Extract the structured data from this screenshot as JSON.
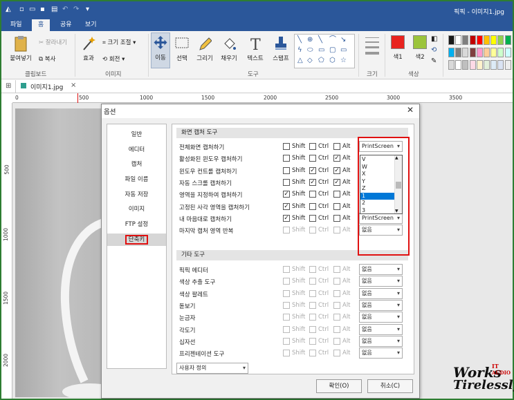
{
  "app": {
    "title": "픽픽 - 이미지1.jpg"
  },
  "tabs": [
    "파일",
    "홈",
    "공유",
    "보기"
  ],
  "ribbon": {
    "paste": "붙여넣기",
    "cut": "잘라내기",
    "copy": "복사",
    "effect": "효과",
    "resize": "크기 조절",
    "rotate": "회전",
    "move": "이동",
    "select": "선택",
    "draw": "그리기",
    "fill": "채우기",
    "text": "텍스트",
    "stamp": "스탬프",
    "size": "크기",
    "color1": "색1",
    "color2": "색2",
    "groups": {
      "clipboard": "클립보드",
      "image": "이미지",
      "tools": "도구",
      "size": "크기",
      "color": "색상"
    },
    "color1_hex": "#e8231f",
    "color2_hex": "#9bc43c",
    "palette": [
      "#1a1a1a",
      "#ffffff",
      "#7f7f7f",
      "#c00000",
      "#ff0000",
      "#ffc000",
      "#ffff00",
      "#92d050",
      "#00b050",
      "#00b0f0",
      "#7f7f7f",
      "#d9d9d9",
      "#7f3f3f",
      "#ff99cc",
      "#ffcc99",
      "#ffff99",
      "#ccffcc",
      "#ccffff",
      "#d9d9d9",
      "#ffffff",
      "#bfbfbf",
      "#ffd9e6",
      "#fff2cc",
      "#e2efda",
      "#ddebf7",
      "#dae3f3",
      "#ededed"
    ]
  },
  "doc": {
    "tab": "이미지1.jpg"
  },
  "ruler": {
    "h": [
      "0",
      "500",
      "1000",
      "1500",
      "2000",
      "2500",
      "3000",
      "3500"
    ],
    "v": [
      "500",
      "1000",
      "1500",
      "2000"
    ]
  },
  "dialog": {
    "title": "옵션",
    "nav": [
      "일반",
      "에디터",
      "캡처",
      "파일 이름",
      "자동 저장",
      "이미지",
      "FTP 설정",
      "단축키"
    ],
    "section1": "화면 캡처 도구",
    "section2": "기타 도구",
    "mod": {
      "shift": "Shift",
      "ctrl": "Ctrl",
      "alt": "Alt"
    },
    "capture_rows": [
      {
        "label": "전체화면 캡처하기",
        "shift": false,
        "ctrl": false,
        "alt": false,
        "key": "PrintScreen"
      },
      {
        "label": "활성화된 윈도우 캡처하기",
        "shift": false,
        "ctrl": false,
        "alt": true,
        "key": ""
      },
      {
        "label": "윈도우 컨트롤 캡처하기",
        "shift": false,
        "ctrl": true,
        "alt": true,
        "key": ""
      },
      {
        "label": "자동 스크롤 캡처하기",
        "shift": false,
        "ctrl": true,
        "alt": true,
        "key": ""
      },
      {
        "label": "영역을 지정하여 캡처하기",
        "shift": true,
        "ctrl": false,
        "alt": false,
        "key": ""
      },
      {
        "label": "고정된 사각 영역을 캡처하기",
        "shift": true,
        "ctrl": false,
        "alt": false,
        "key": ""
      },
      {
        "label": "내 마음대로 캡처하기",
        "shift": true,
        "ctrl": false,
        "alt": false,
        "key": "PrintScreen"
      },
      {
        "label": "마지막 캡처 영역 반복",
        "shift": false,
        "ctrl": false,
        "alt": false,
        "key": "없음"
      }
    ],
    "dropdown_items": [
      "V",
      "W",
      "X",
      "Y",
      "Z",
      "1",
      "2",
      "3"
    ],
    "dropdown_selected": "1",
    "other_rows": [
      {
        "label": "픽픽 에디터",
        "key": "없음"
      },
      {
        "label": "색상 추출 도구",
        "key": "없음"
      },
      {
        "label": "색상 팔레트",
        "key": "없음"
      },
      {
        "label": "돋보기",
        "key": "없음"
      },
      {
        "label": "눈금자",
        "key": "없음"
      },
      {
        "label": "각도기",
        "key": "없음"
      },
      {
        "label": "십자선",
        "key": "없음"
      },
      {
        "label": "프리젠테이션 도구",
        "key": "없음"
      }
    ],
    "preset": "사용자 정의",
    "ok": "확인(O)",
    "cancel": "취소(C)"
  },
  "watermark": {
    "line1": "Works",
    "it": "IT",
    "audio": "AUDIO",
    "line2": "Tirelessly"
  }
}
